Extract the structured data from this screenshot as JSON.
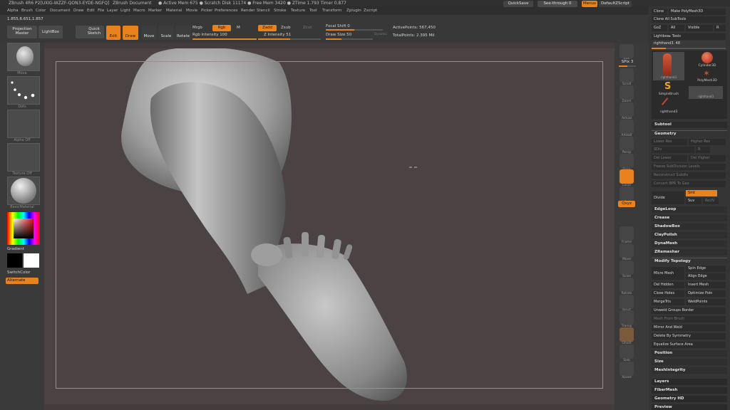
{
  "titlebar": {
    "app": "ZBrush 4R6 P2[UXIG-WZZF-QON3-EYDE-NGFQ]",
    "doc": "ZBrush Document",
    "stats": "● Active Mem 675 ● Scratch Disk 11174 ● Free Mem 3420 ● ZTime 1.793 Timer 0.877"
  },
  "menu": {
    "items": [
      "Alpha",
      "Brush",
      "Color",
      "Document",
      "Draw",
      "Edit",
      "File",
      "Layer",
      "Light",
      "Macro",
      "Marker",
      "Material",
      "Movie",
      "Picker",
      "Preferences",
      "Render",
      "Stencil",
      "Stroke",
      "Texture",
      "Tool",
      "Transform",
      "Zplugin",
      "Zscript"
    ],
    "quicksave": "QuickSave",
    "see_through": "See-through  0",
    "menus": "Menus",
    "default_script": "DefaultZScript"
  },
  "shelf": {
    "coords": "1.855,6.651,1.857",
    "projection_master": "Projection Master",
    "lightbox": "LightBox",
    "quick_sketch": "Quick Sketch",
    "edit": "Edit",
    "draw": "Draw",
    "move": "Move",
    "scale": "Scale",
    "rotate": "Rotate",
    "mrgb": "Mrgb",
    "rgb": "Rgb",
    "m": "M",
    "rgb_intensity": "Rgb Intensity 100",
    "zadd": "Zadd",
    "zsub": "Zsub",
    "zcut": "Zcut",
    "z_intensity": "Z Intensity 51",
    "focal_shift": "Focal Shift 0",
    "draw_size": "Draw Size 50",
    "dynamic": "Dynamic",
    "active_points": "ActivePoints: 567,450",
    "total_points": "TotalPoints: 2.395 Mil"
  },
  "left": {
    "brush_label": "Move",
    "stroke_label": "Dots",
    "alpha_label": "Alpha Off",
    "texture_label": "Texture Off",
    "material_label": "BasicMaterial",
    "gradient": "Gradient",
    "switch_color": "SwitchColor",
    "alternate": "Alternate"
  },
  "right": {
    "items": [
      "BPR",
      "SPix 3",
      "Scroll",
      "Zoom",
      "Actual",
      "AAHalf",
      "Persp",
      "Floor",
      "Local",
      "L.Sym",
      "Qxyz",
      "Frame",
      "Move",
      "Scale",
      "Rotate",
      "PolyF",
      "Transp",
      "Ghost",
      "Solo",
      "Xpose"
    ]
  },
  "palette": {
    "clone": "Clone",
    "make_polymesh": "Make PolyMesh3D",
    "clone_all": "Clone All SubTools",
    "goz": "GoZ",
    "all": "All",
    "visible": "Visible",
    "r": "R",
    "lightbox_tools": "Lightbox▸ Tools",
    "current_tool": "righthand3. 48",
    "tools": [
      "righthand3",
      "Cylinder3D",
      "SimpleBrush",
      "PolyMesh3D",
      "righthand3",
      "righthand3"
    ],
    "subtool": "Subtool",
    "geometry": "Geometry",
    "lower_res": "Lower Res",
    "higher_res": "Higher Res",
    "sdiv": "SDiv",
    "del_lower": "Del Lower",
    "del_higher": "Del Higher",
    "freeze_subdiv": "Freeze SubDivision Levels",
    "reconstruct": "Reconstruct Subdiv",
    "convert_bpr": "Convert BPR To Geo",
    "divide": "Divide",
    "smt": "Smt",
    "suv": "Suv",
    "reuv": "ReUV",
    "geo_items": [
      "EdgeLoop",
      "Crease",
      "ShadowBox",
      "ClayPolish",
      "DynaMesh",
      "ZRemesher"
    ],
    "modify_topology": "Modify Topology",
    "micro_mesh": "Micro Mesh",
    "spin_edge": "Spin Edge",
    "align_edge": "Align Edge",
    "del_hidden": "Del Hidden",
    "insert_mesh": "Insert Mesh",
    "close_holes": "Close Holes",
    "optimize_points": "Optimize Poin",
    "merge_tris": "MergeTris",
    "weld_points": "WeldPoints",
    "unweld": "Unweld Groups Border",
    "mesh_from_brush": "Mesh From Brush",
    "mirror_weld": "Mirror And Weld",
    "delete_symmetry": "Delete By Symmetry",
    "equalize": "Equalize Surface Area",
    "position": "Position",
    "size": "Size",
    "mesh_integrity": "MeshIntegrity",
    "layers": "Layers",
    "fibermesh": "FiberMesh",
    "geometry_hd": "Geometry HD",
    "preview": "Preview"
  }
}
